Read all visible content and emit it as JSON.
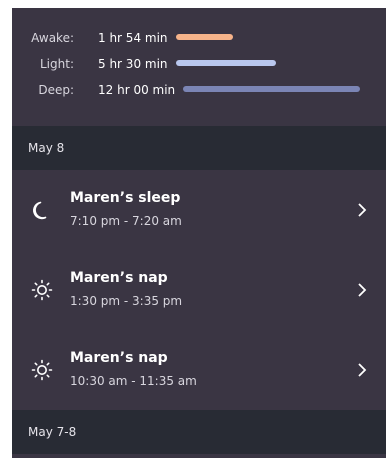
{
  "summary": {
    "stats": [
      {
        "label": "Awake:",
        "value": "1 hr 54 min",
        "color": "#f6b38a",
        "fraction": 0.32
      },
      {
        "label": "Light:",
        "value": "5 hr 30 min",
        "color": "#b9c7ee",
        "fraction": 0.56
      },
      {
        "label": "Deep:",
        "value": "12 hr 00 min",
        "color": "#7b85b5",
        "fraction": 1.0
      }
    ]
  },
  "sections": [
    {
      "header": "May 8",
      "items": [
        {
          "icon": "moon-icon",
          "title": "Maren’s sleep",
          "time": "7:10 pm - 7:20 am"
        },
        {
          "icon": "sun-icon",
          "title": "Maren’s nap",
          "time": "1:30 pm - 3:35 pm"
        },
        {
          "icon": "sun-icon",
          "title": "Maren’s nap",
          "time": "10:30 am - 11:35 am"
        }
      ]
    },
    {
      "header": "May 7-8",
      "items": []
    }
  ]
}
